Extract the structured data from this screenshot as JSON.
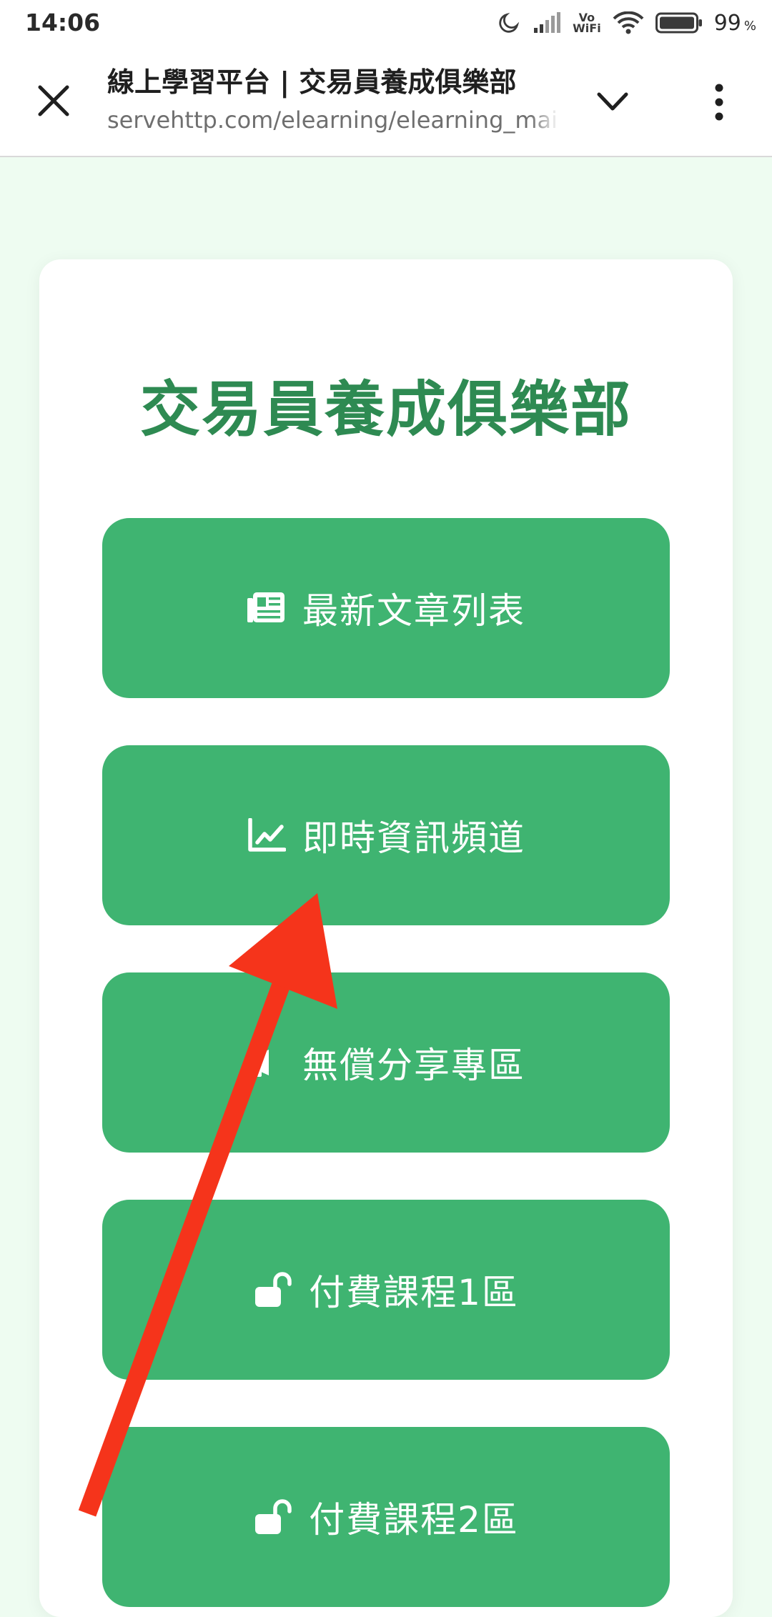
{
  "status_bar": {
    "time": "14:06",
    "network_badge_top": "Vo",
    "network_badge_bottom": "WiFi",
    "battery_level": "99",
    "battery_unit": "%"
  },
  "browser": {
    "page_title": "線上學習平台 | 交易員養成俱樂部",
    "url": "servehttp.com/elearning/elearning_main"
  },
  "page": {
    "heading": "交易員養成俱樂部",
    "menu": [
      {
        "label": "最新文章列表",
        "icon": "newspaper-icon"
      },
      {
        "label": "即時資訊頻道",
        "icon": "chart-line-icon"
      },
      {
        "label": "無償分享專區",
        "icon": "megaphone-icon"
      },
      {
        "label": "付費課程1區",
        "icon": "unlock-icon"
      },
      {
        "label": "付費課程2區",
        "icon": "unlock-icon"
      }
    ]
  },
  "colors": {
    "page_background": "#eefcf1",
    "brand_green": "#2e8a52",
    "button_green": "#3fb471",
    "annotation_arrow": "#f5341b"
  }
}
